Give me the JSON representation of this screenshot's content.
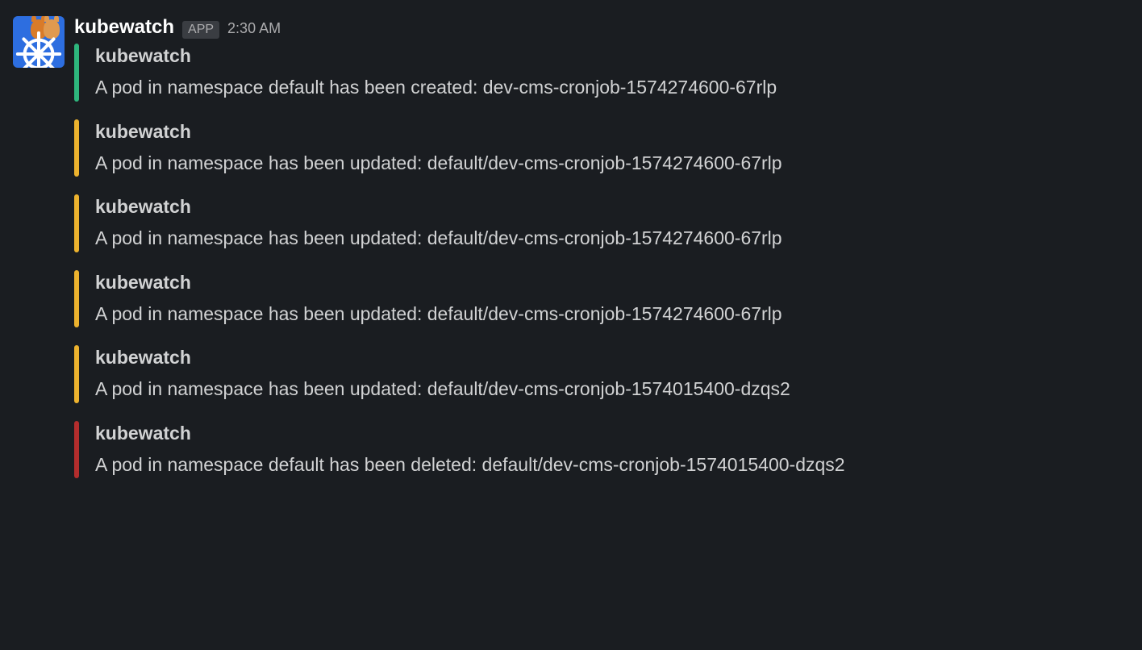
{
  "message": {
    "sender": "kubewatch",
    "badge": "APP",
    "timestamp": "2:30 AM"
  },
  "attachments": [
    {
      "color": "green",
      "title": "kubewatch",
      "text": "A pod in namespace default has been created: dev-cms-cronjob-1574274600-67rlp"
    },
    {
      "color": "yellow",
      "title": "kubewatch",
      "text": "A pod in namespace  has been updated: default/dev-cms-cronjob-1574274600-67rlp"
    },
    {
      "color": "yellow",
      "title": "kubewatch",
      "text": "A pod in namespace  has been updated: default/dev-cms-cronjob-1574274600-67rlp"
    },
    {
      "color": "yellow",
      "title": "kubewatch",
      "text": "A pod in namespace  has been updated: default/dev-cms-cronjob-1574274600-67rlp"
    },
    {
      "color": "yellow",
      "title": "kubewatch",
      "text": "A pod in namespace  has been updated: default/dev-cms-cronjob-1574015400-dzqs2"
    },
    {
      "color": "red",
      "title": "kubewatch",
      "text": "A pod in namespace default has been deleted: default/dev-cms-cronjob-1574015400-dzqs2"
    }
  ]
}
